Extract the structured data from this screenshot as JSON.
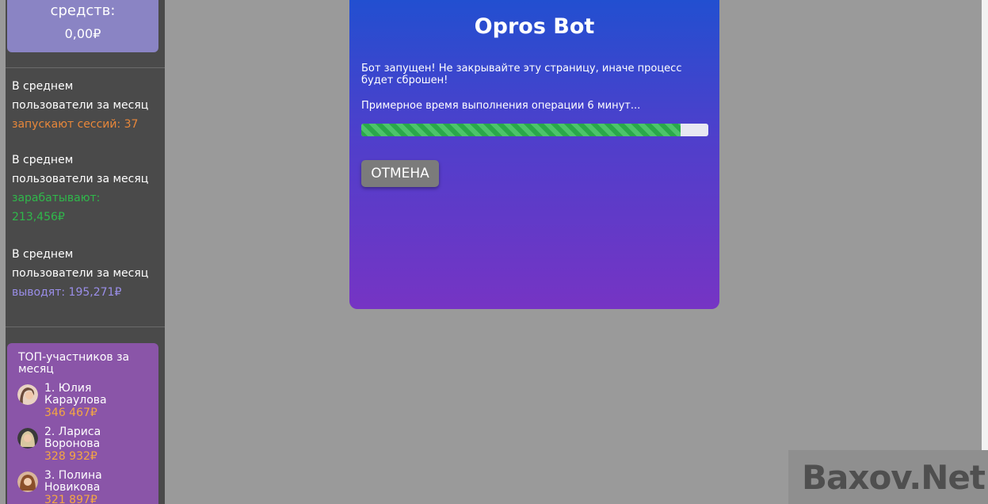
{
  "sidebar": {
    "balance": {
      "label": "средств:",
      "value": "0,00₽"
    },
    "stats": [
      {
        "line1": "В среднем",
        "line2": "пользователи за месяц",
        "highlight": "запускают сессий: 37",
        "color": "#e8873a"
      },
      {
        "line1": "В среднем",
        "line2": "пользователи за месяц",
        "highlight": "зарабатывают: 213,456₽",
        "color": "#2fb84a"
      },
      {
        "line1": "В среднем",
        "line2": "пользователи за месяц",
        "highlight": "выводят: 195,271₽",
        "color": "#9a8ee8"
      }
    ],
    "top": {
      "title": "ТОП-участников за месяц",
      "items": [
        {
          "name": "1. Юлия Караулова",
          "amount": "346 467₽"
        },
        {
          "name": "2. Лариса Воронова",
          "amount": "328 932₽"
        },
        {
          "name": "3. Полина Новикова",
          "amount": "321 897₽"
        }
      ]
    }
  },
  "panel": {
    "title": "Opros Bot",
    "message": "Бот запущен! Не закрывайте эту страницу, иначе процесс будет сброшен!",
    "eta": "Примерное время выполнения операции 6 минут...",
    "progress_percent": 92,
    "cancel_label": "ОТМЕНА"
  },
  "watermark": "Baxov.Net",
  "colors": {
    "panel_top": "#224fd0",
    "panel_bottom": "#7634c4",
    "progress": "#2aa84a",
    "amount": "#f5a742"
  }
}
